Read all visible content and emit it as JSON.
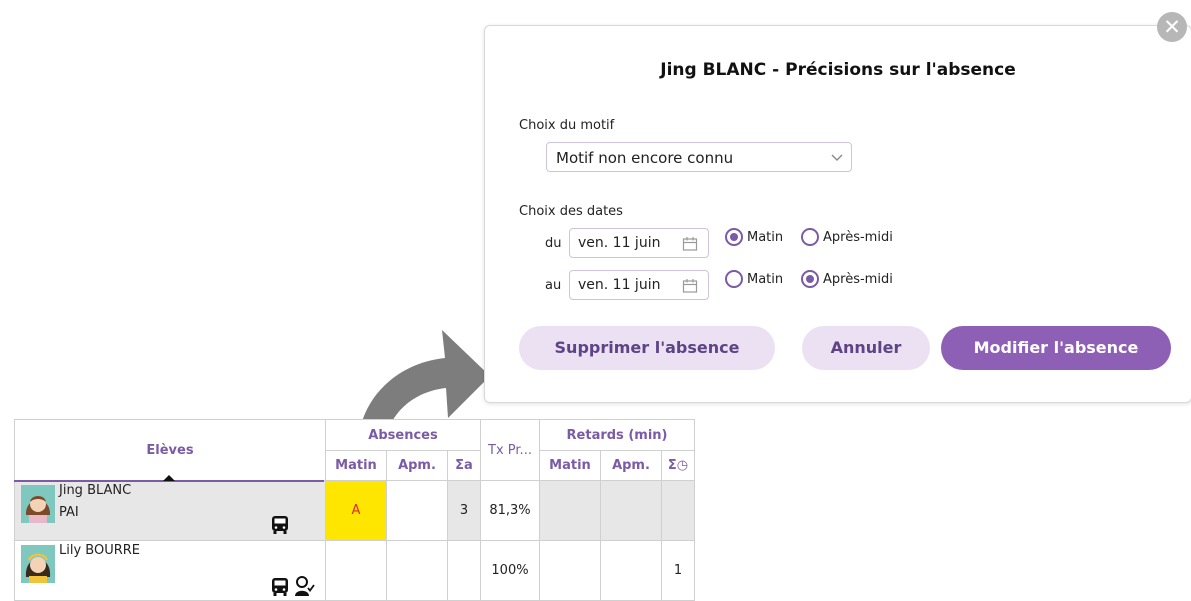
{
  "dialog": {
    "title": "Jing BLANC - Précisions sur l'absence",
    "close_symbol": "✕",
    "motif_label": "Choix du motif",
    "motif_value": "Motif non encore connu",
    "dates_label": "Choix des dates",
    "from": {
      "prefix": "du",
      "date": "ven. 11 juin",
      "morning": "Matin",
      "afternoon": "Après-midi",
      "selected": "morning"
    },
    "to": {
      "prefix": "au",
      "date": "ven. 11 juin",
      "morning": "Matin",
      "afternoon": "Après-midi",
      "selected": "afternoon"
    },
    "buttons": {
      "delete": "Supprimer l'absence",
      "cancel": "Annuler",
      "modify": "Modifier l'absence"
    }
  },
  "table": {
    "col_students": "Elèves",
    "group_absences": "Absences",
    "group_rate": "Tx Pr...",
    "group_delays": "Retards (min)",
    "sub": {
      "matin": "Matin",
      "apm": "Apm.",
      "sum_a": "Σa",
      "sum_clock": "Σ◷"
    },
    "rows": [
      {
        "name": "Jing BLANC",
        "sub": "PAI",
        "abs_matin": "A",
        "abs_apm": "",
        "sum_a": "3",
        "rate": "81,3%",
        "ret_matin": "",
        "ret_apm": "",
        "sum_ret": ""
      },
      {
        "name": "Lily BOURRE",
        "sub": "",
        "abs_matin": "",
        "abs_apm": "",
        "sum_a": "",
        "rate": "100%",
        "ret_matin": "",
        "ret_apm": "",
        "sum_ret": "1"
      }
    ]
  },
  "colors": {
    "accent": "#7b5ba6",
    "button_dark": "#8d5fb5",
    "button_light": "#ebe1f3",
    "absence_cell": "#ffe600",
    "absence_text": "#e0262c"
  },
  "icons": [
    "close-icon",
    "chevron-down-icon",
    "calendar-icon",
    "bus-icon",
    "person-check-icon",
    "curved-arrow-icon",
    "avatar-icon"
  ]
}
